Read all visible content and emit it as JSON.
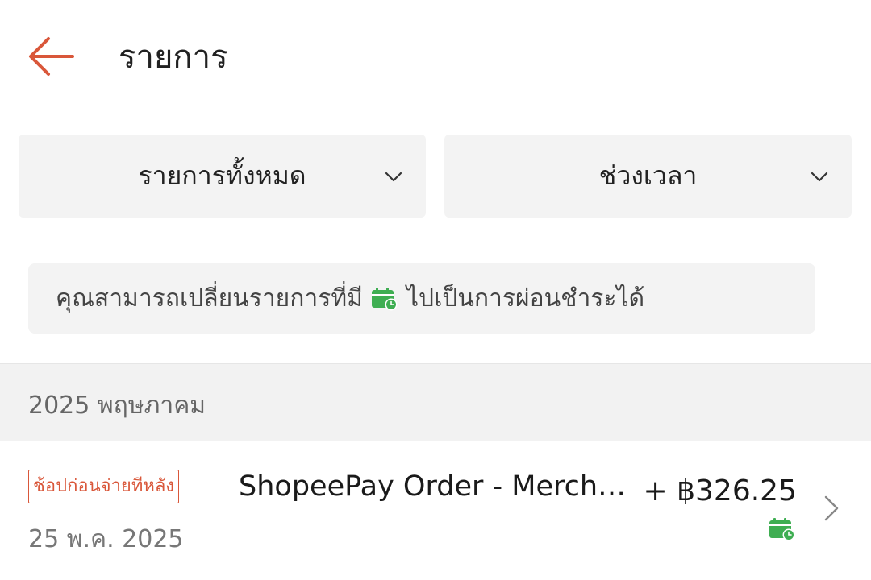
{
  "header": {
    "title": "รายการ",
    "back_icon": "arrow-left-icon",
    "accent_color": "#d9573a"
  },
  "filters": {
    "type_label": "รายการทั้งหมด",
    "period_label": "ช่วงเวลา",
    "chevron_icon": "chevron-down-icon"
  },
  "banner": {
    "text_before": "คุณสามารถเปลี่ยนรายการที่มี",
    "icon": "calendar-clock-icon",
    "text_after": "ไปเป็นการผ่อนชำระได้",
    "icon_color": "#3fae52"
  },
  "section": {
    "month_label": "2025 พฤษภาคม"
  },
  "transactions": [
    {
      "tag": "ช้อปก่อนจ่ายทีหลัง",
      "title": "ShopeePay Order - Merchant",
      "date": "25 พ.ค. 2025",
      "amount": "+ ฿326.25",
      "installment_icon": "calendar-clock-icon",
      "chevron_icon": "chevron-right-icon"
    }
  ]
}
